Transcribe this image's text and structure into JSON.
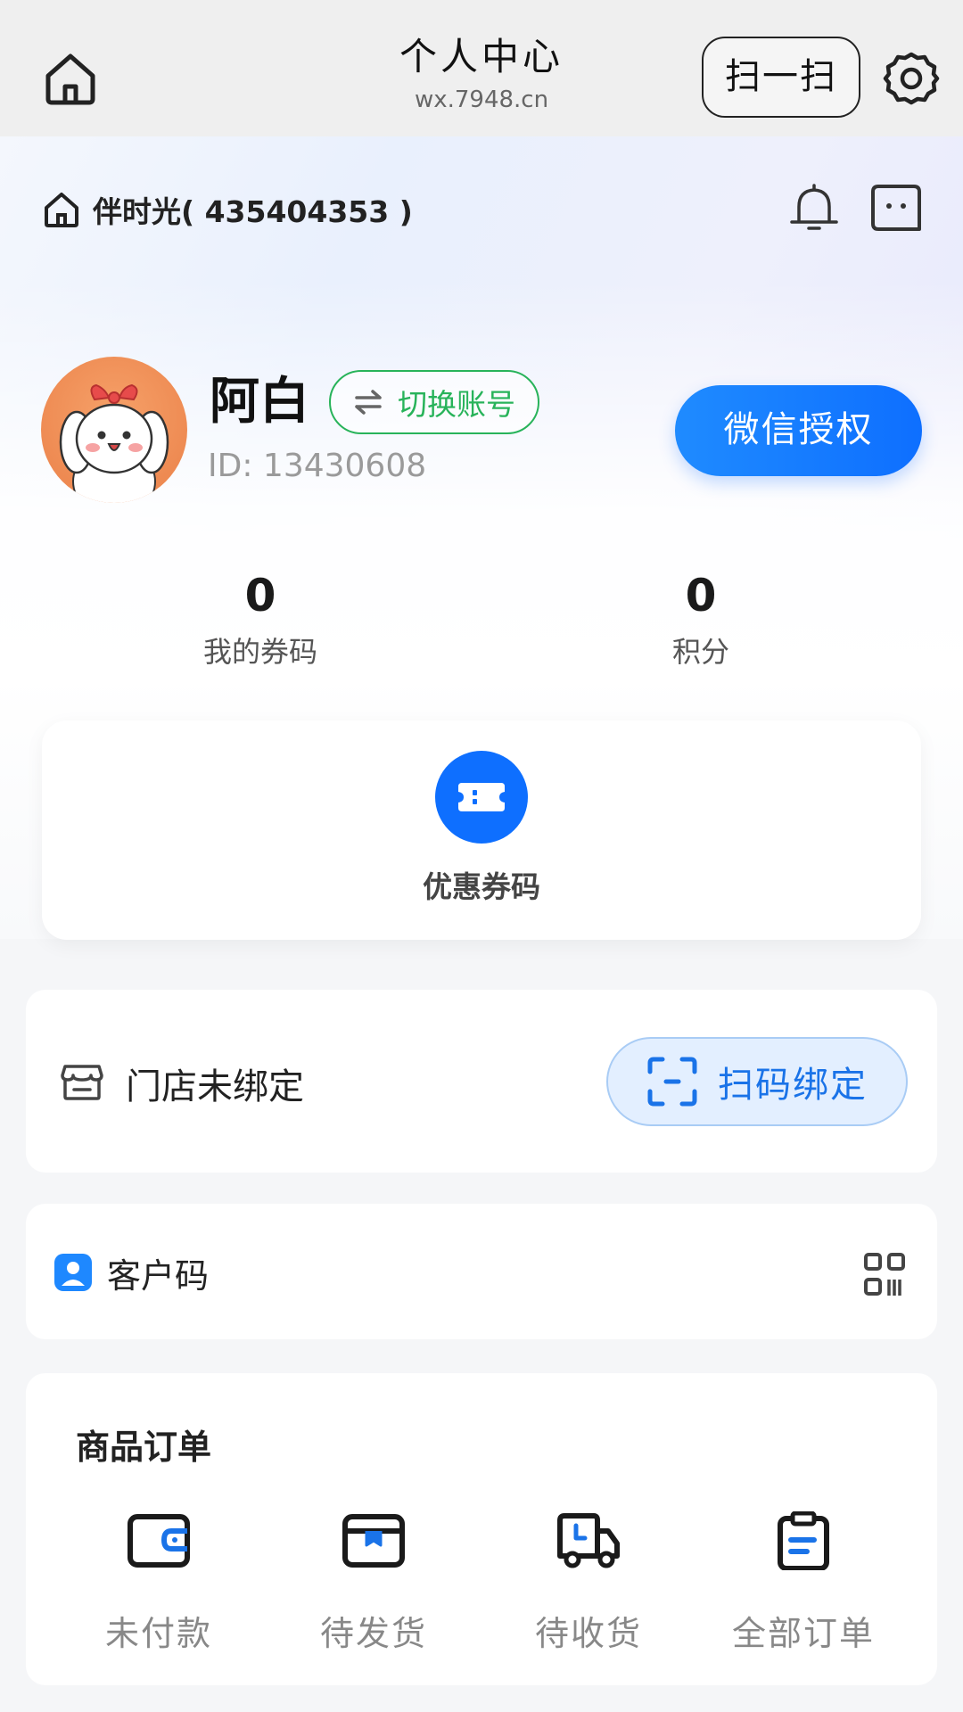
{
  "topbar": {
    "title": "个人中心",
    "subtitle": "wx.7948.cn",
    "scan_label": "扫一扫"
  },
  "store": {
    "name": "伴时光( 435404353 )"
  },
  "profile": {
    "username": "阿白",
    "switch_label": "切换账号",
    "user_id": "ID: 13430608",
    "wechat_auth_label": "微信授权"
  },
  "stats": [
    {
      "value": "0",
      "label": "我的券码"
    },
    {
      "value": "0",
      "label": "积分"
    }
  ],
  "coupon_card": {
    "label": "优惠券码"
  },
  "bind_card": {
    "status": "门店未绑定",
    "button_label": "扫码绑定"
  },
  "customer_card": {
    "label": "客户码"
  },
  "orders": {
    "title": "商品订单",
    "items": [
      {
        "label": "未付款",
        "icon": "wallet-icon"
      },
      {
        "label": "待发货",
        "icon": "package-icon"
      },
      {
        "label": "待收货",
        "icon": "truck-icon"
      },
      {
        "label": "全部订单",
        "icon": "clipboard-icon"
      }
    ]
  },
  "colors": {
    "primary_blue": "#0e6fff",
    "switch_green": "#28b35a",
    "page_bg": "#f5f6f8"
  }
}
